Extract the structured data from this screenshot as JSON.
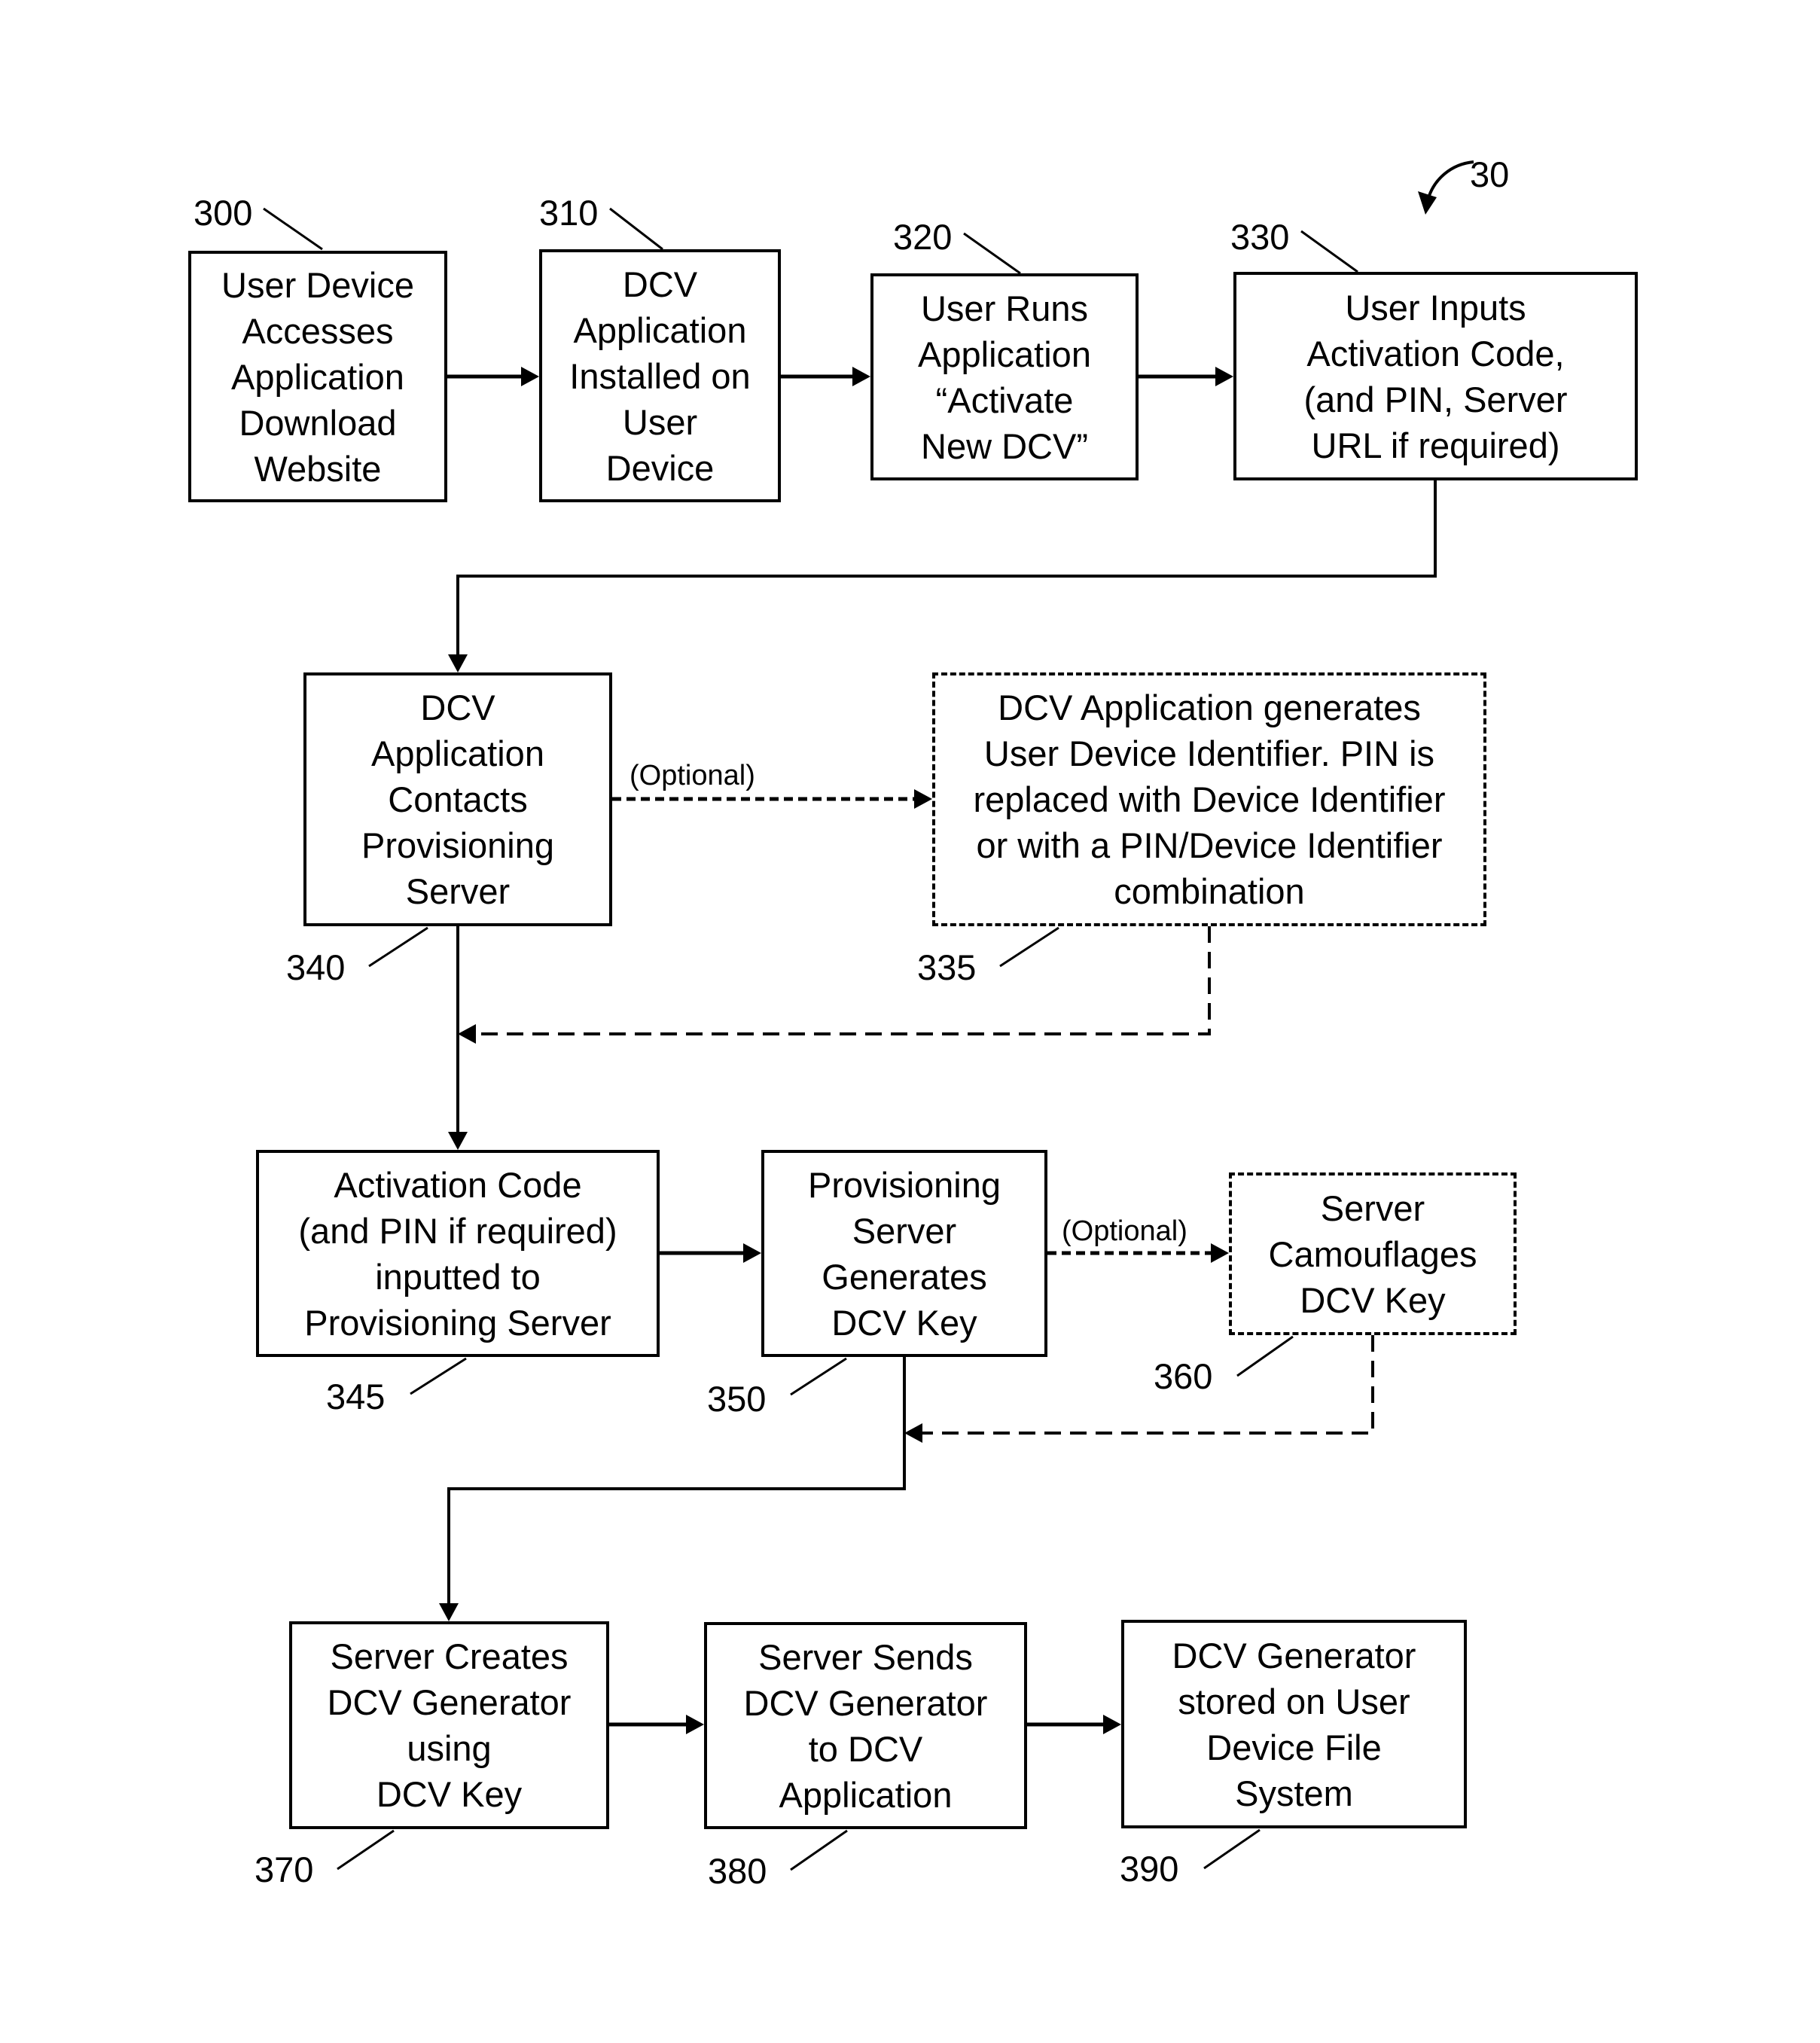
{
  "figure": {
    "reference": "30"
  },
  "steps": {
    "s300": {
      "ref": "300",
      "text": "User Device\nAccesses\nApplication\nDownload\nWebsite",
      "optional": false
    },
    "s310": {
      "ref": "310",
      "text": "DCV\nApplication\nInstalled on\nUser\nDevice",
      "optional": false
    },
    "s320": {
      "ref": "320",
      "text": "User Runs\nApplication\n“Activate\nNew DCV”",
      "optional": false
    },
    "s330": {
      "ref": "330",
      "text": "User Inputs\nActivation Code,\n(and PIN, Server\nURL if required)",
      "optional": false
    },
    "s340": {
      "ref": "340",
      "text": "DCV\nApplication\nContacts\nProvisioning\nServer",
      "optional": false
    },
    "s335": {
      "ref": "335",
      "text": "DCV Application generates\nUser Device Identifier.  PIN is\nreplaced with Device Identifier\nor with a PIN/Device Identifier\ncombination",
      "optional": true
    },
    "s345": {
      "ref": "345",
      "text": "Activation Code\n(and PIN if required)\ninputted to\nProvisioning Server",
      "optional": false
    },
    "s350": {
      "ref": "350",
      "text": "Provisioning\nServer\nGenerates\nDCV Key",
      "optional": false
    },
    "s360": {
      "ref": "360",
      "text": "Server\nCamouflages\nDCV Key",
      "optional": true
    },
    "s370": {
      "ref": "370",
      "text": "Server Creates\nDCV Generator\nusing\nDCV Key",
      "optional": false
    },
    "s380": {
      "ref": "380",
      "text": "Server Sends\nDCV Generator\nto DCV\nApplication",
      "optional": false
    },
    "s390": {
      "ref": "390",
      "text": "DCV Generator\nstored on User\nDevice File\nSystem",
      "optional": false
    }
  },
  "edge_labels": {
    "opt_340_335": "(Optional)",
    "opt_350_360": "(Optional)"
  },
  "edges": [
    {
      "from": "300",
      "to": "310",
      "style": "solid"
    },
    {
      "from": "310",
      "to": "320",
      "style": "solid"
    },
    {
      "from": "320",
      "to": "330",
      "style": "solid"
    },
    {
      "from": "330",
      "to": "340",
      "style": "solid"
    },
    {
      "from": "340",
      "to": "335",
      "style": "dashed",
      "label": "(Optional)"
    },
    {
      "from": "335",
      "to": "340-345 line",
      "style": "dashed"
    },
    {
      "from": "340",
      "to": "345",
      "style": "solid"
    },
    {
      "from": "345",
      "to": "350",
      "style": "solid"
    },
    {
      "from": "350",
      "to": "360",
      "style": "dashed",
      "label": "(Optional)"
    },
    {
      "from": "360",
      "to": "350-370 line",
      "style": "dashed"
    },
    {
      "from": "350",
      "to": "370",
      "style": "solid"
    },
    {
      "from": "370",
      "to": "380",
      "style": "solid"
    },
    {
      "from": "380",
      "to": "390",
      "style": "solid"
    }
  ]
}
